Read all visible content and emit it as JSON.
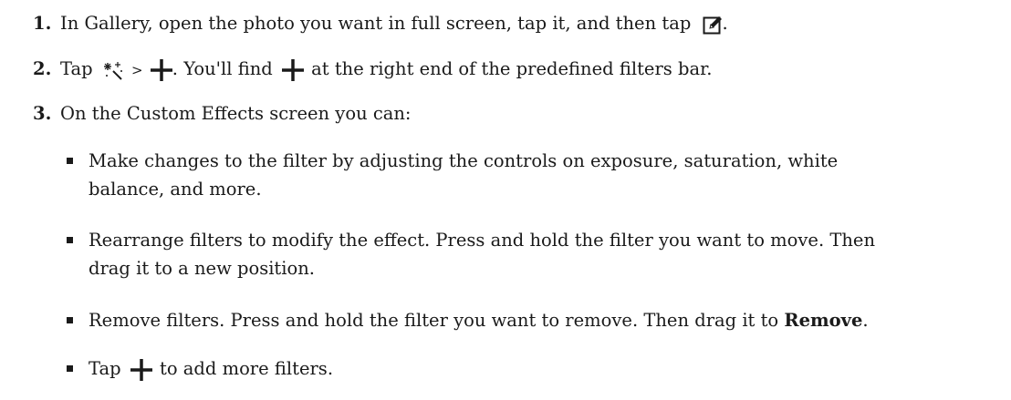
{
  "steps": [
    {
      "number": "1.",
      "before_icon": "In Gallery, open the photo you want in full screen, tap it, and then tap",
      "icon": "edit-icon",
      "after_icon": "."
    },
    {
      "number": "2.",
      "part1": "Tap",
      "icon_effects": "effects-wand-icon",
      "part2": ">",
      "icon_plus": "plus-icon",
      "part3": ". You'll find",
      "part4": "at the right end of the predefined filters bar."
    },
    {
      "number": "3.",
      "text": "On the Custom Effects screen you can:"
    }
  ],
  "substeps": [
    {
      "text": "Make changes to the filter by adjusting the controls on exposure, saturation, white balance, and more."
    },
    {
      "text": "Rearrange filters to modify the effect. Press and hold the filter you want to move. Then drag it to a new position."
    },
    {
      "before_bold": "Remove filters. Press and hold the filter you want to remove. Then drag it to",
      "bold": "Remove",
      "after_bold": "."
    },
    {
      "before_icon": "Tap",
      "icon": "plus-icon",
      "after_icon": "to add more filters."
    }
  ]
}
